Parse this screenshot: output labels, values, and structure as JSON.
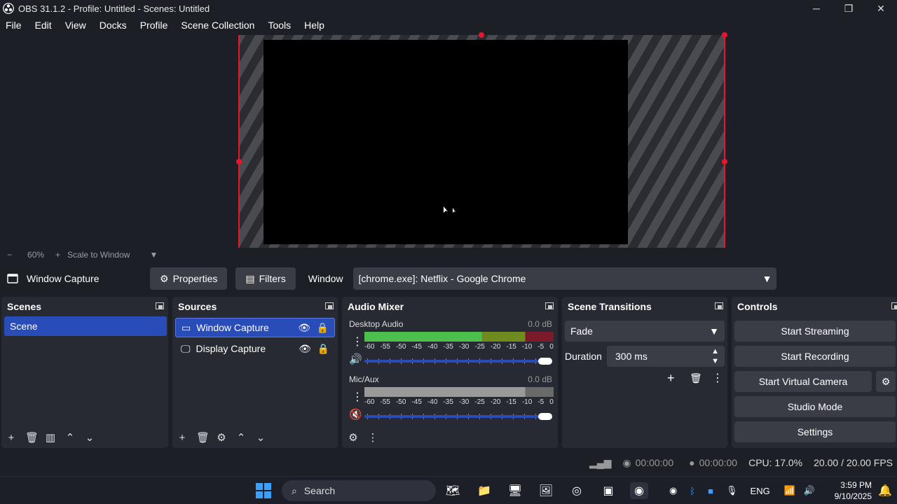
{
  "window": {
    "title": "OBS 31.1.2 - Profile: Untitled - Scenes: Untitled",
    "minimize": "─",
    "restore": "❐",
    "close": "✕"
  },
  "menu": [
    "File",
    "Edit",
    "View",
    "Docks",
    "Profile",
    "Scene Collection",
    "Tools",
    "Help"
  ],
  "zoom": {
    "minus": "−",
    "value": "60%",
    "plus": "+",
    "mode": "Scale to Window"
  },
  "source_toolbar": {
    "source_name": "Window Capture",
    "properties_label": "Properties",
    "filters_label": "Filters",
    "window_label": "Window",
    "window_value": "[chrome.exe]: Netflix - Google Chrome"
  },
  "scenes": {
    "title": "Scenes",
    "items": [
      "Scene"
    ]
  },
  "sources": {
    "title": "Sources",
    "items": [
      "Window Capture",
      "Display Capture"
    ]
  },
  "audio_mixer": {
    "title": "Audio Mixer",
    "channels": [
      {
        "name": "Desktop Audio",
        "db": "0.0 dB",
        "muted": false
      },
      {
        "name": "Mic/Aux",
        "db": "0.0 dB",
        "muted": true
      }
    ],
    "scale": [
      "-60",
      "-55",
      "-50",
      "-45",
      "-40",
      "-35",
      "-30",
      "-25",
      "-20",
      "-15",
      "-10",
      "-5",
      "0"
    ]
  },
  "scene_transitions": {
    "title": "Scene Transitions",
    "transition": "Fade",
    "duration_label": "Duration",
    "duration_value": "300 ms"
  },
  "controls": {
    "title": "Controls",
    "start_streaming": "Start Streaming",
    "start_recording": "Start Recording",
    "start_virtual_camera": "Start Virtual Camera",
    "studio_mode": "Studio Mode",
    "settings": "Settings"
  },
  "status": {
    "stream_time": "00:00:00",
    "record_time": "00:00:00",
    "cpu": "CPU: 17.0%",
    "fps": "20.00 / 20.00 FPS"
  },
  "taskbar": {
    "search_placeholder": "Search",
    "language": "ENG",
    "time": "3:59 PM",
    "date": "9/10/2025"
  },
  "colors": {
    "accent": "#284cb8",
    "bounding_box": "#e8152c",
    "meter_green": "#4cbf4c",
    "background": "#1d1f26",
    "dock": "#272a33"
  }
}
